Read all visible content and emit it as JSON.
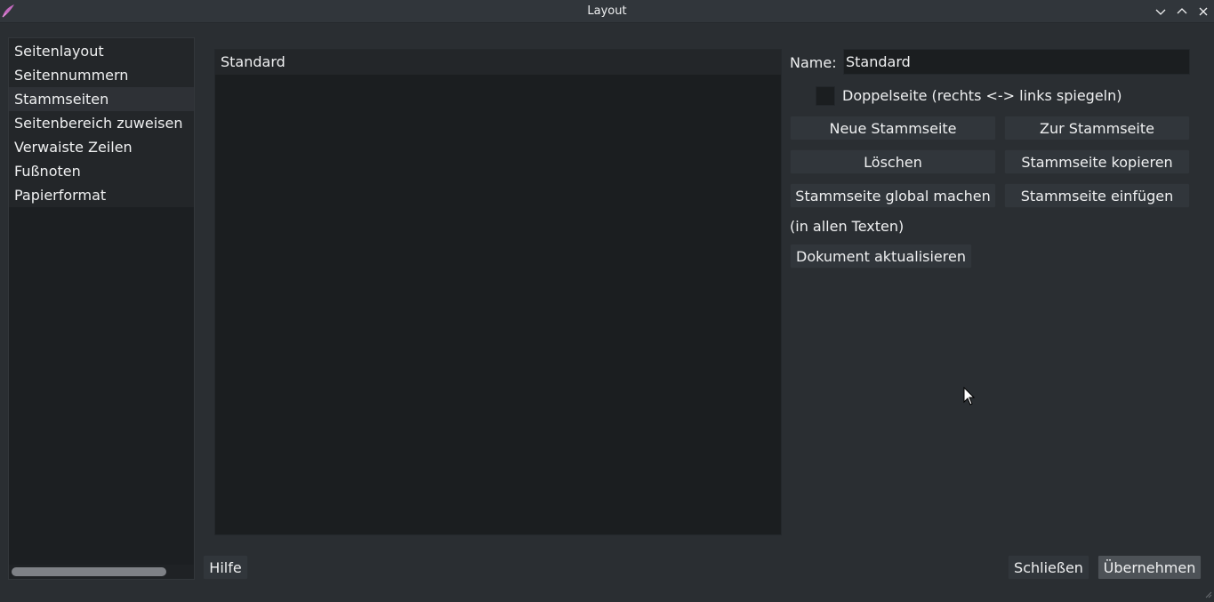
{
  "window": {
    "title": "Layout"
  },
  "sidebar": {
    "items": [
      {
        "label": "Seitenlayout"
      },
      {
        "label": "Seitennummern"
      },
      {
        "label": "Stammseiten"
      },
      {
        "label": "Seitenbereich zuweisen"
      },
      {
        "label": "Verwaiste Zeilen"
      },
      {
        "label": "Fußnoten"
      },
      {
        "label": "Papierformat"
      }
    ],
    "selected_index": 2
  },
  "master_pages": {
    "items": [
      {
        "label": "Standard"
      }
    ]
  },
  "form": {
    "name_label": "Name:",
    "name_value": "Standard",
    "double_page_label": "Doppelseite (rechts <-> links spiegeln)",
    "double_page_checked": false,
    "note": "(in allen Texten)"
  },
  "buttons": {
    "new_master": "Neue Stammseite",
    "goto_master": "Zur Stammseite",
    "delete": "Löschen",
    "copy_master": "Stammseite kopieren",
    "make_global": "Stammseite global machen",
    "insert_master": "Stammseite einfügen",
    "update_document": "Dokument aktualisieren",
    "help": "Hilfe",
    "close": "Schließen",
    "apply": "Übernehmen"
  },
  "colors": {
    "window_bg": "#2a2e32",
    "list_bg": "#1b1e20",
    "button_bg": "#31363b",
    "text": "#eff0f1"
  }
}
